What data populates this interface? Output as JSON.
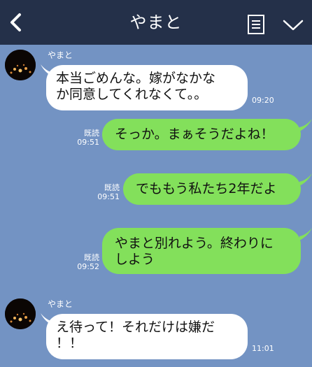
{
  "header": {
    "title": "やまと",
    "back_icon": "chevron-left-icon",
    "notes_icon": "notes-icon",
    "menu_icon": "chevron-down-icon",
    "background": "#243049"
  },
  "chat": {
    "background": "#7393c3",
    "messages": [
      {
        "direction": "incoming",
        "sender": "やまと",
        "lines": [
          "本当ごめんな。嫁がなかな",
          "か同意してくれなくて。。"
        ],
        "time": "09:20"
      },
      {
        "direction": "outgoing",
        "read_label": "既読",
        "lines": [
          "そっか。まぁそうだよね！"
        ],
        "time": "09:51"
      },
      {
        "direction": "outgoing",
        "read_label": "既読",
        "lines": [
          "でももう私たち2年だよ"
        ],
        "time": "09:51"
      },
      {
        "direction": "outgoing",
        "read_label": "既読",
        "lines": [
          "やまと別れよう。終わりに",
          "しよう"
        ],
        "time": "09:52"
      },
      {
        "direction": "incoming",
        "sender": "やまと",
        "lines": [
          "え待って！それだけは嫌だ",
          "！！"
        ],
        "time": "11:01"
      }
    ]
  },
  "colors": {
    "incoming_bubble": "#ffffff",
    "outgoing_bubble": "#83e05b"
  }
}
